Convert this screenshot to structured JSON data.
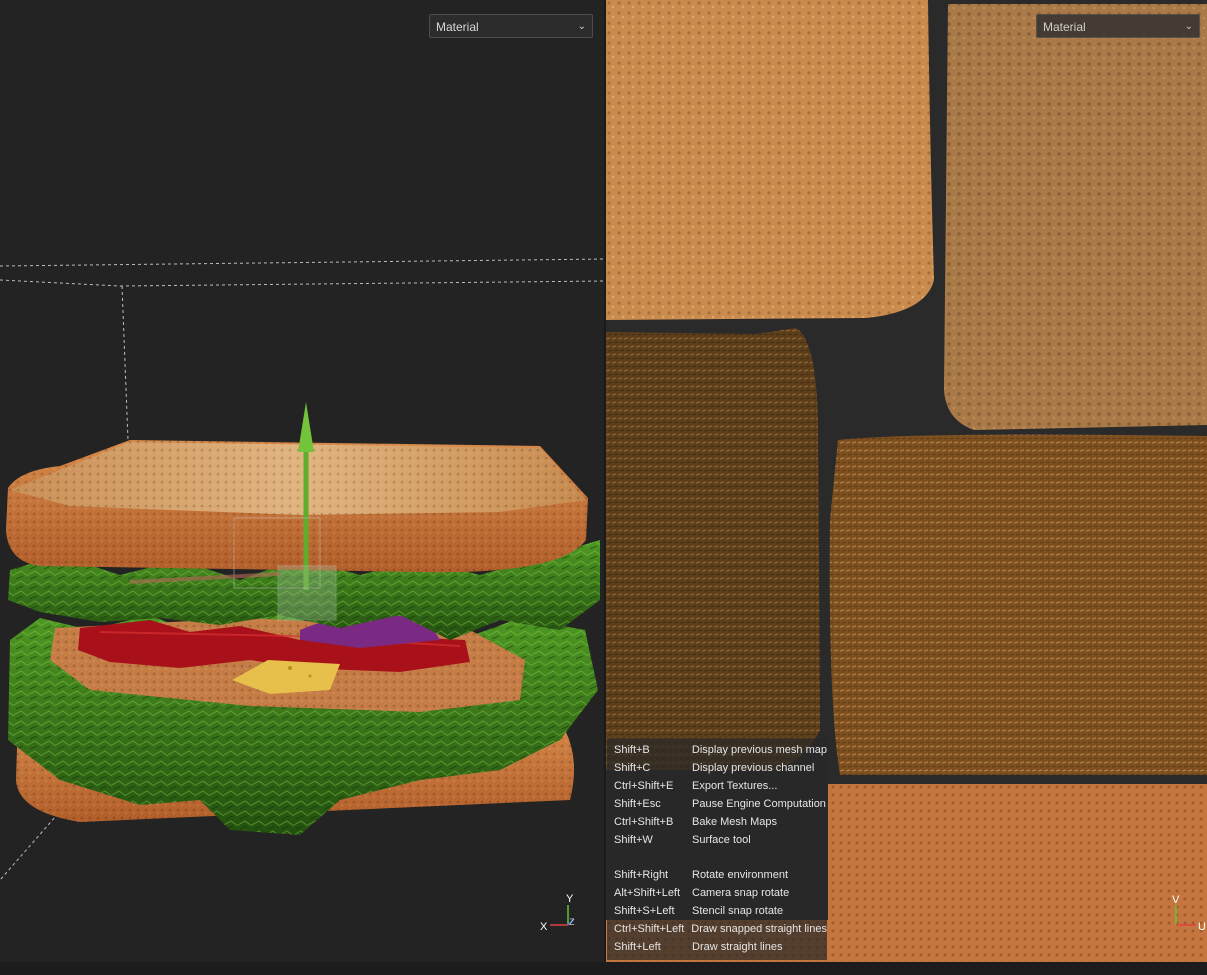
{
  "viewport_3d": {
    "mode_select": {
      "value": "Material"
    },
    "axis_gizmo": {
      "x": "X",
      "y": "Y",
      "z": "Z"
    }
  },
  "viewport_2d": {
    "mode_select": {
      "value": "Material"
    },
    "axis_gizmo": {
      "v": "V",
      "u": "U"
    }
  },
  "shortcuts": [
    {
      "key": "Shift+B",
      "action": "Display previous mesh map"
    },
    {
      "key": "Shift+C",
      "action": "Display previous channel"
    },
    {
      "key": "Ctrl+Shift+E",
      "action": "Export Textures..."
    },
    {
      "key": "Shift+Esc",
      "action": "Pause Engine Computation"
    },
    {
      "key": "Ctrl+Shift+B",
      "action": "Bake Mesh Maps"
    },
    {
      "key": "Shift+W",
      "action": "Surface tool"
    },
    {
      "key": "",
      "action": ""
    },
    {
      "key": "Shift+Right",
      "action": "Rotate environment"
    },
    {
      "key": "Alt+Shift+Left",
      "action": "Camera snap rotate"
    },
    {
      "key": "Shift+S+Left",
      "action": "Stencil snap rotate"
    },
    {
      "key": "Ctrl+Shift+Left",
      "action": "Draw snapped straight lines"
    },
    {
      "key": "Shift+Left",
      "action": "Draw straight lines"
    }
  ],
  "colors": {
    "background": "#232323",
    "bread_crust": "#c8733a",
    "bread_top": "#d89a5a",
    "lettuce": "#3f8a1e",
    "tomato": "#b0121a",
    "onion": "#7a2a7a",
    "cheese": "#e8c24a",
    "gizmo_green": "#6ab832"
  }
}
